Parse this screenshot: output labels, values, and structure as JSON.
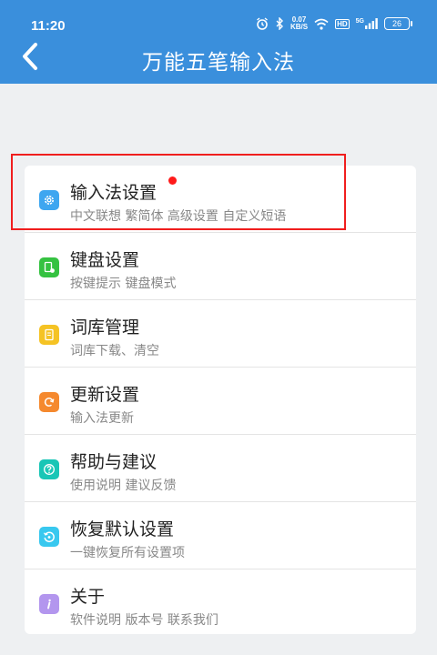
{
  "status_bar": {
    "time": "11:20",
    "speed_value": "0.07",
    "speed_unit": "KB/S",
    "hd_label": "HD",
    "signal_label": "5G",
    "battery": "26"
  },
  "header": {
    "title": "万能五笔输入法",
    "back_icon": "chevron-left-icon"
  },
  "menu": {
    "items": [
      {
        "icon": "gear-icon",
        "color": "#3ea6f0",
        "label": "输入法设置",
        "sub": "中文联想 繁简体 高级设置 自定义短语",
        "badge": true
      },
      {
        "icon": "keyboard-icon",
        "color": "#35c241",
        "label": "键盘设置",
        "sub": "按键提示 键盘模式",
        "badge": false
      },
      {
        "icon": "book-icon",
        "color": "#f5c324",
        "label": "词库管理",
        "sub": "词库下载、清空",
        "badge": false
      },
      {
        "icon": "refresh-icon",
        "color": "#f5892e",
        "label": "更新设置",
        "sub": "输入法更新",
        "badge": false
      },
      {
        "icon": "help-icon",
        "color": "#19c6b6",
        "label": "帮助与建议",
        "sub": "使用说明 建议反馈",
        "badge": false
      },
      {
        "icon": "restore-icon",
        "color": "#38c8ef",
        "label": "恢复默认设置",
        "sub": "一键恢复所有设置项",
        "badge": false
      },
      {
        "icon": "info-icon",
        "color": "#b396ee",
        "label": "关于",
        "sub": "软件说明 版本号 联系我们",
        "badge": false
      }
    ]
  },
  "accent_colors": {
    "header": "#3a8fdc",
    "highlight": "#f01e1e",
    "badge": "#ff1a1a"
  }
}
